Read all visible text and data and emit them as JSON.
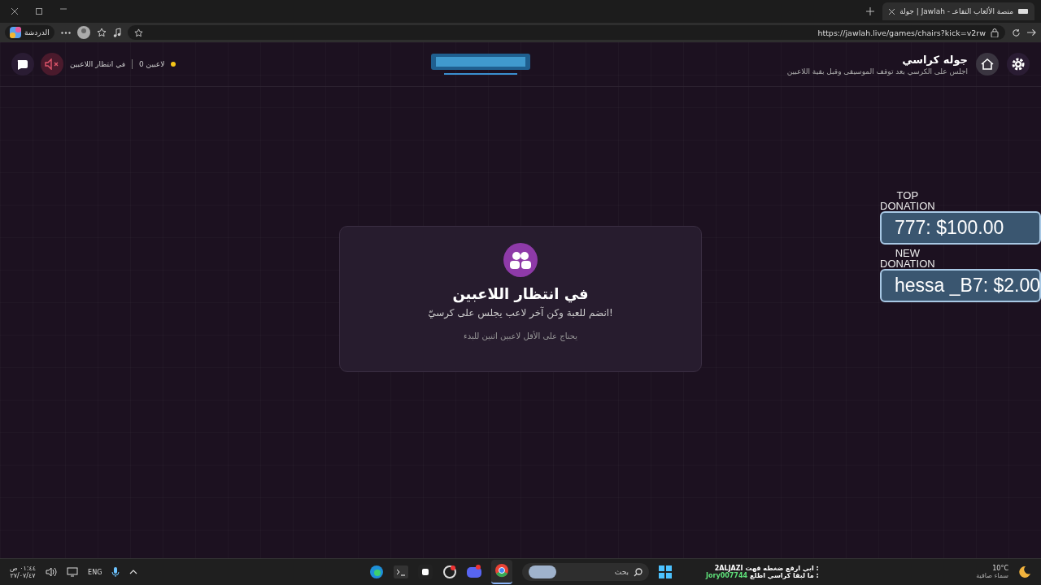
{
  "browser": {
    "tab": {
      "title": "جولة | Jawlah - منصة الألعاب التفاعـ",
      "selected": true
    },
    "url": "https://jawlah.live/games/chairs?kick=v2rw",
    "chat_button": "الدردشة"
  },
  "header": {
    "title": "جوله كراسي",
    "subtitle": "اجلس على الكرسي بعد توقف الموسيقى وقبل بقية اللاعبين",
    "status": "في انتظار اللاعبين",
    "players": "0 لاعبين",
    "muted": true
  },
  "card": {
    "title": "في انتظار اللاعبين",
    "text": "انضم للعبة وكن آخر لاعب يجلس على كرسيّ!",
    "hint": "يحتاج على الأقل لاعبين اثنين للبدء"
  },
  "donations": [
    {
      "label_1": "TOP",
      "label_2": "DONATION",
      "value": "777: $100.00"
    },
    {
      "label_1": "NEW",
      "label_2": "DONATION",
      "value": "hessa _B7: $2.00"
    }
  ],
  "taskbar": {
    "time": "٠١:٤٤ ص",
    "date": "٢٧/٠٧/٤٧",
    "language": "ENG",
    "search": "بحث",
    "chat": [
      {
        "user": "2ALJAZI",
        "text": ": ابي ارقع ضغطه قهت"
      },
      {
        "user": "Jory007744",
        "text": ": ما لبقا كراسي اطلع"
      }
    ],
    "temperature": "10°C",
    "weather": "سماء صافية"
  }
}
